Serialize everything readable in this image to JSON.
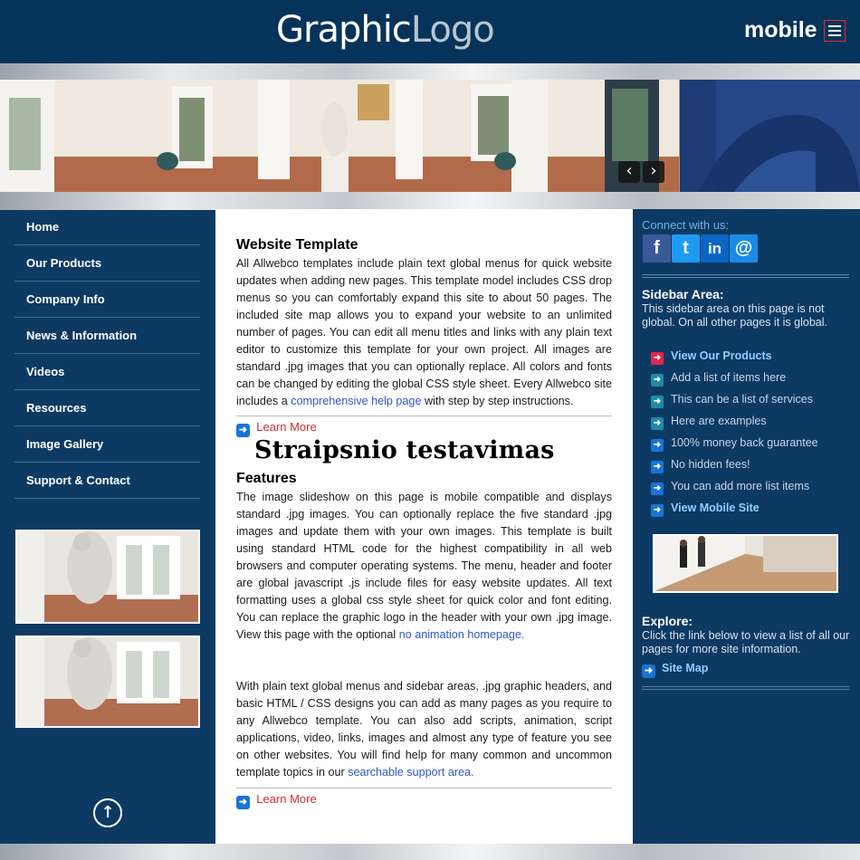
{
  "header": {
    "logo_part1": "Graphic",
    "logo_part2": "Logo",
    "mobile_label": "mobile"
  },
  "slideshow": {
    "prev_icon": "chevron-left-icon",
    "next_icon": "chevron-right-icon"
  },
  "nav": {
    "items": [
      "Home",
      "Our Products",
      "Company Info",
      "News & Information",
      "Videos",
      "Resources",
      "Image Gallery",
      "Support & Contact"
    ]
  },
  "main": {
    "title1": "Website Template",
    "para1": "All Allwebco templates include plain text global menus for quick website updates when adding new pages. This template model includes CSS drop menus so you can comfortably expand this site to about 50 pages. The included site map allows you to expand your website to an unlimited number of pages. You can edit all menu titles and links with any plain text editor to customize this template for your own project. All images are standard .jpg images that you can optionally replace. All colors and fonts can be changed by editing the global CSS style sheet. Every Allwebco site includes a ",
    "para1_link": "comprehensive help page",
    "para1_end": " with step by step instructions.",
    "learn_more_1": "Learn More",
    "big_heading": "Straipsnio testavimas",
    "title2": "Features",
    "para2": "The image slideshow on this page is mobile compatible and displays standard .jpg images. You can optionally replace the five standard .jpg images and update them with your own images. This template is built using standard HTML code for the highest compatibility in all web browsers and computer operating systems. The menu, header and footer are global javascript .js include files for easy website updates. All text formatting uses a global css style sheet for quick color and font editing. You can replace the graphic logo in the header with your own .jpg image. View this page with the optional ",
    "para2_link": "no animation homepage.",
    "para3": "With plain text global menus and sidebar areas, .jpg graphic headers, and basic HTML / CSS designs you can add as many pages as you require to any Allwebco template. You can also add scripts, animation, script applications, video, links, images and almost any type of feature you see on other websites. You will find help for many common and uncommon template topics in our ",
    "para3_link": "searchable support area.",
    "learn_more_2": "Learn More"
  },
  "sidebar": {
    "connect": "Connect with us:",
    "social": [
      "f",
      "t",
      "in",
      "@"
    ],
    "area_title": "Sidebar Area:",
    "area_desc": "This sidebar area on this page is not global. On all other pages it is global.",
    "list": [
      {
        "label": "View Our Products",
        "bold": true,
        "color": "#d9272e"
      },
      {
        "label": "Add a list of items here",
        "bold": false,
        "color": "#1e8aa8"
      },
      {
        "label": "This can be a list of services",
        "bold": false,
        "color": "#1e8aa8"
      },
      {
        "label": "Here are examples",
        "bold": false,
        "color": "#1e8aa8"
      },
      {
        "label": "100% money back guarantee",
        "bold": false,
        "color": "#1874d8"
      },
      {
        "label": "No hidden fees!",
        "bold": false,
        "color": "#1874d8"
      },
      {
        "label": "You can add more list items",
        "bold": false,
        "color": "#1874d8"
      },
      {
        "label": "View Mobile Site",
        "bold": true,
        "color": "#1874d8"
      }
    ],
    "explore_title": "Explore:",
    "explore_desc": "Click the link below to view a list of all our pages for more site information.",
    "sitemap": "Site Map"
  },
  "colors": {
    "header_bg": "#06335a",
    "page_bg": "#0d3a63",
    "link": "#2f56cf",
    "learn_more": "#d9272e"
  }
}
